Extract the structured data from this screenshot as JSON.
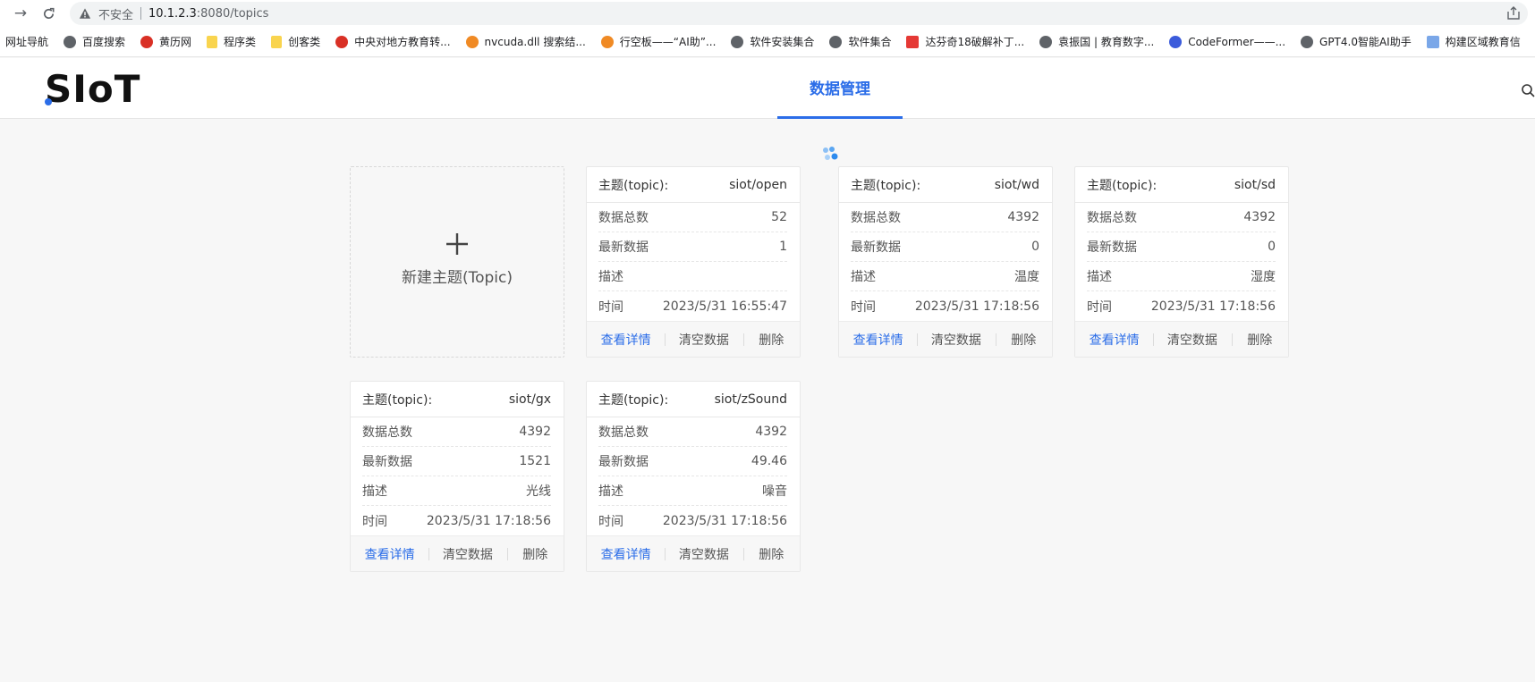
{
  "browser": {
    "insecure_label": "不安全",
    "url_host": "10.1.2.3",
    "url_rest": ":8080/topics"
  },
  "bookmarks": [
    {
      "label": "网址导航",
      "icon": "none"
    },
    {
      "label": "百度搜索",
      "icon": "globe"
    },
    {
      "label": "黄历网",
      "icon": "red"
    },
    {
      "label": "程序类",
      "icon": "folder"
    },
    {
      "label": "创客类",
      "icon": "folder"
    },
    {
      "label": "中央对地方教育转...",
      "icon": "red"
    },
    {
      "label": "nvcuda.dll 搜索结...",
      "icon": "orange"
    },
    {
      "label": "行空板——“AI助”...",
      "icon": "orange"
    },
    {
      "label": "软件安装集合",
      "icon": "globe"
    },
    {
      "label": "软件集合",
      "icon": "globe"
    },
    {
      "label": "达芬奇18破解补丁...",
      "icon": "sq"
    },
    {
      "label": "袁振国 | 教育数字...",
      "icon": "globe"
    },
    {
      "label": "CodeFormer——...",
      "icon": "blue"
    },
    {
      "label": "GPT4.0智能AI助手",
      "icon": "globe"
    },
    {
      "label": "构建区域教育信",
      "icon": "doc"
    }
  ],
  "header": {
    "logo_text": "SIoT",
    "nav_tab": "数据管理"
  },
  "new_topic": {
    "label": "新建主题(Topic)"
  },
  "labels": {
    "topic": "主题(topic):",
    "total": "数据总数",
    "latest": "最新数据",
    "desc": "描述",
    "time": "时间",
    "view": "查看详情",
    "clear": "清空数据",
    "delete": "删除"
  },
  "topics": [
    {
      "name": "siot/open",
      "total": "52",
      "latest": "1",
      "desc": "",
      "time": "2023/5/31 16:55:47"
    },
    {
      "name": "siot/wd",
      "total": "4392",
      "latest": "0",
      "desc": "温度",
      "time": "2023/5/31 17:18:56"
    },
    {
      "name": "siot/sd",
      "total": "4392",
      "latest": "0",
      "desc": "湿度",
      "time": "2023/5/31 17:18:56"
    },
    {
      "name": "siot/gx",
      "total": "4392",
      "latest": "1521",
      "desc": "光线",
      "time": "2023/5/31 17:18:56"
    },
    {
      "name": "siot/zSound",
      "total": "4392",
      "latest": "49.46",
      "desc": "噪音",
      "time": "2023/5/31 17:18:56"
    }
  ],
  "colors": {
    "accent": "#2b6de8",
    "background": "#f7f7f7"
  }
}
